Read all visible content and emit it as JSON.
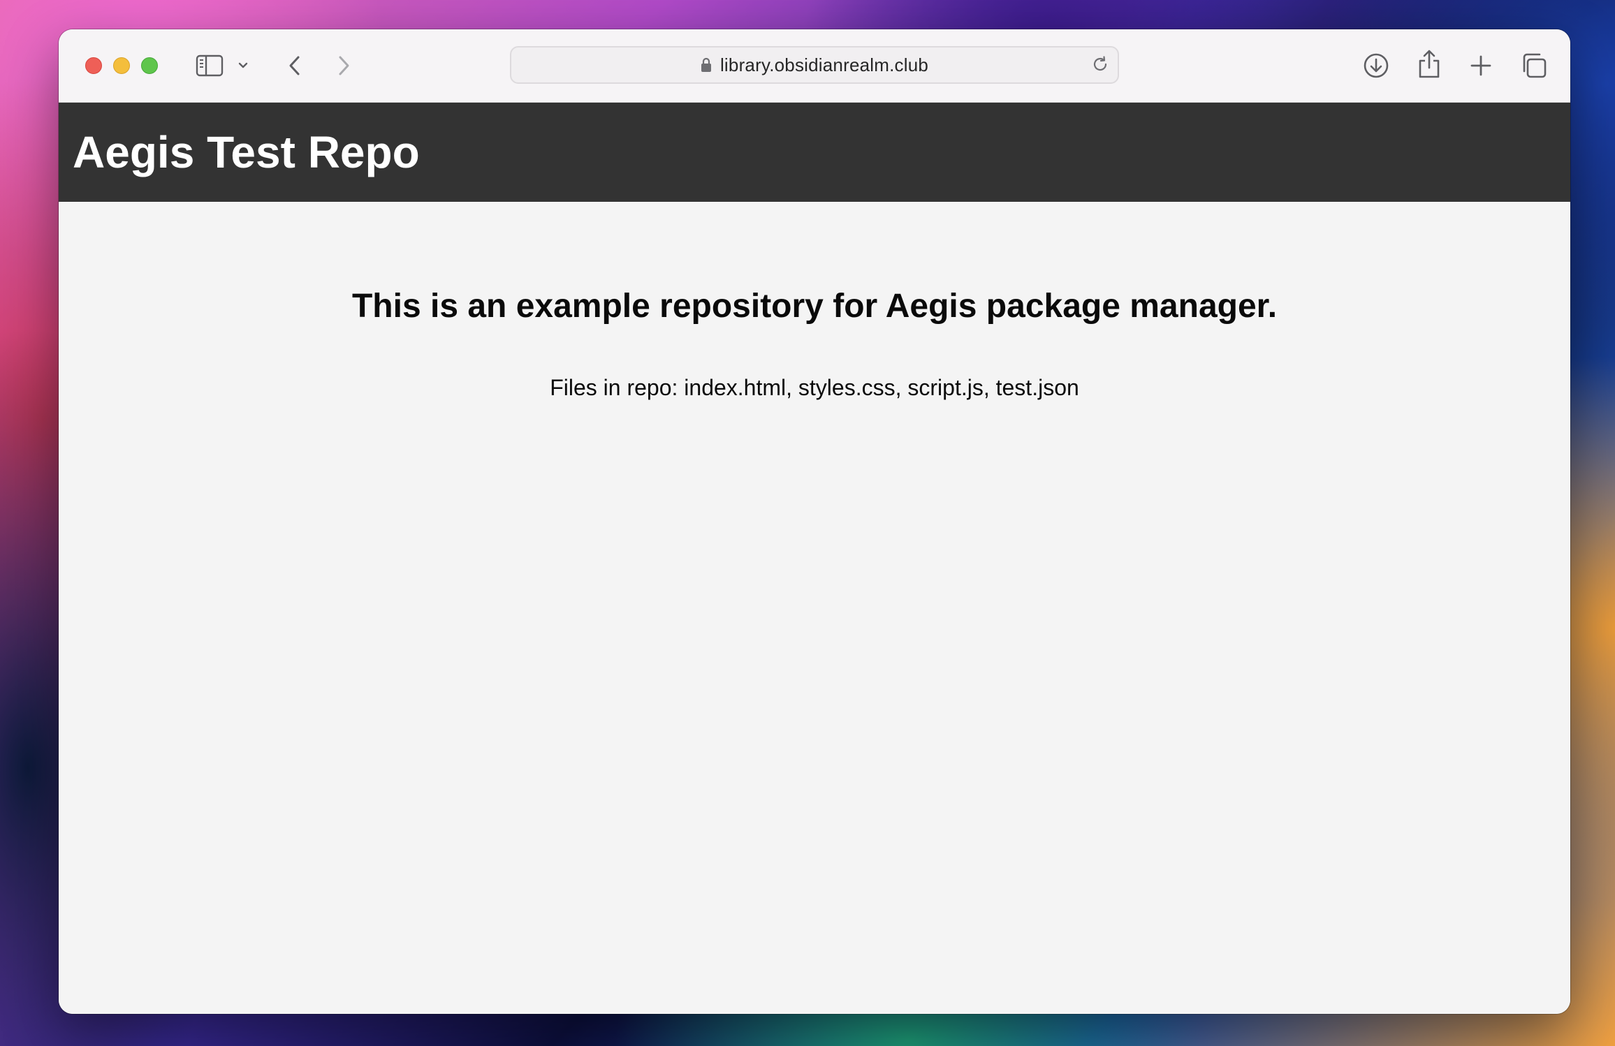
{
  "browser": {
    "url": "library.obsidianrealm.club",
    "icons": {
      "sidebar": "sidebar-icon",
      "sidebar_menu": "chevron-down-icon",
      "back": "chevron-left-icon",
      "forward": "chevron-right-icon",
      "lock": "lock-icon",
      "reload": "reload-icon",
      "download": "download-icon",
      "share": "share-icon",
      "new_tab": "plus-icon",
      "tab_overview": "tabs-icon"
    },
    "traffic_lights": {
      "close": "#ee5f57",
      "minimize": "#f4be3c",
      "maximize": "#5fc54c"
    }
  },
  "page": {
    "header_title": "Aegis Test Repo",
    "heading": "This is an example repository for Aegis package manager.",
    "files_text": "Files in repo: index.html, styles.css, script.js, test.json",
    "colors": {
      "header_background": "#333333",
      "page_background": "#f4f4f4",
      "header_text": "#ffffff"
    }
  }
}
